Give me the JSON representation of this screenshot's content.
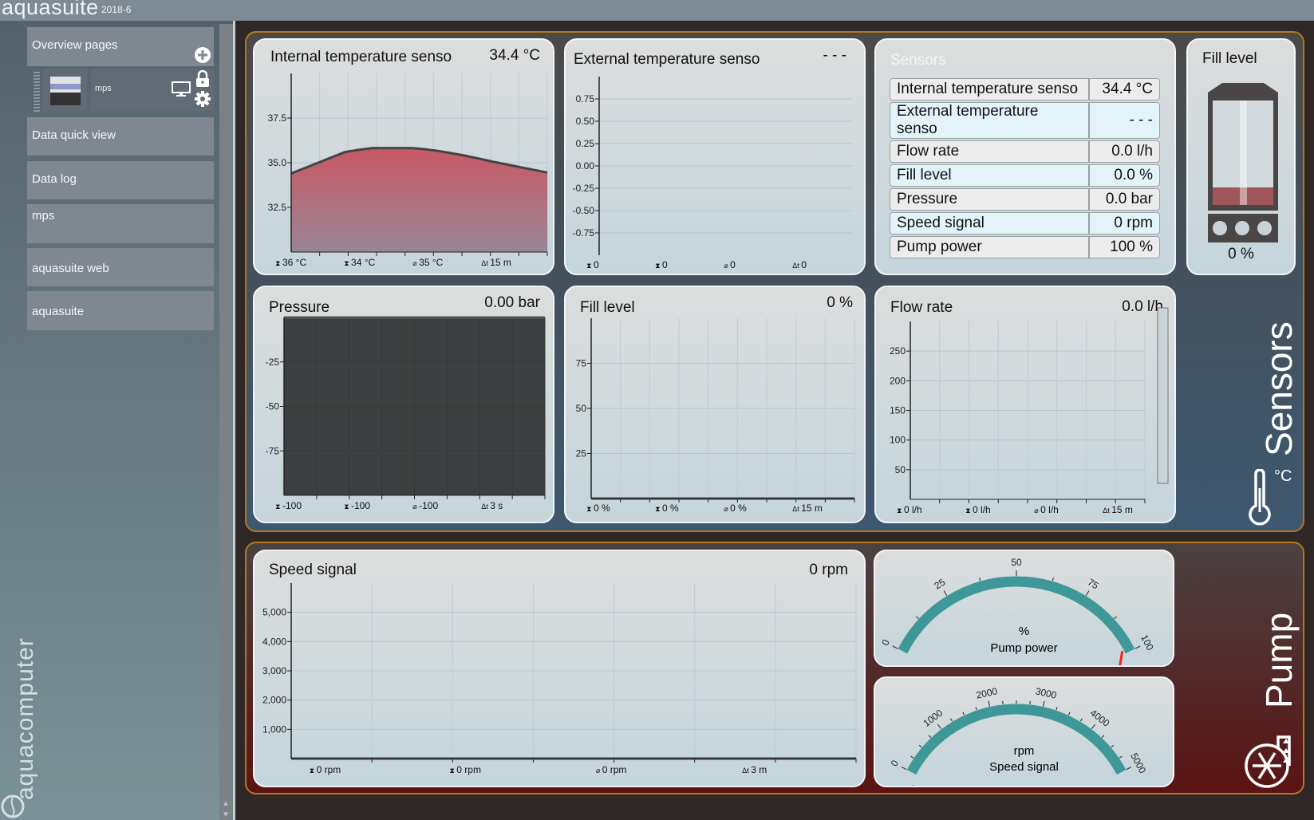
{
  "app": {
    "name": "aquasuite",
    "version": "2018-6",
    "logo_text": "aquacomputer"
  },
  "sidebar": {
    "overview_pages": "Overview pages",
    "page_item": {
      "label": "mps"
    },
    "items": [
      {
        "label": "Data quick view"
      },
      {
        "label": "Data log"
      },
      {
        "label": "mps"
      },
      {
        "label": "aquasuite web"
      },
      {
        "label": "aquasuite"
      }
    ]
  },
  "groups": {
    "sensors": "Sensors",
    "pump": "Pump",
    "temp_unit": "°C"
  },
  "sensor_table": {
    "title": "Sensors",
    "rows": [
      {
        "label": "Internal temperature senso",
        "value": "34.4 °C"
      },
      {
        "label": "External temperature senso",
        "value": "- - -"
      },
      {
        "label": "Flow rate",
        "value": "0.0 l/h"
      },
      {
        "label": "Fill level",
        "value": "0.0 %"
      },
      {
        "label": "Pressure",
        "value": "0.0 bar"
      },
      {
        "label": "Speed signal",
        "value": "0 rpm"
      },
      {
        "label": "Pump power",
        "value": "100 %"
      }
    ]
  },
  "fill_widget": {
    "title": "Fill level",
    "value": "0 %",
    "level_fraction": 0.1
  },
  "colors": {
    "accent": "#b1781e",
    "gauge": "#3f9898",
    "temp_fill": "#c85a64",
    "row_a": "#ececec",
    "row_b": "#e2f3fa"
  },
  "chart_data": [
    {
      "id": "internal",
      "type": "area",
      "title": "Internal temperature senso",
      "value": "34.4 °C",
      "ylim": [
        30,
        40
      ],
      "yticks": [
        37.5,
        35.0,
        32.5
      ],
      "ytick_labels": [
        "37.5",
        "35.0",
        "32.5"
      ],
      "values": [
        34.4,
        34.7,
        35.0,
        35.3,
        35.6,
        35.72,
        35.82,
        35.82,
        35.82,
        35.82,
        35.75,
        35.65,
        35.52,
        35.38,
        35.22,
        35.05,
        34.9,
        34.75,
        34.6,
        34.45
      ],
      "stats": [
        {
          "icon": "max",
          "label": "36 °C"
        },
        {
          "icon": "min",
          "label": "34 °C"
        },
        {
          "icon": "avg",
          "label": "35 °C"
        },
        {
          "icon": "dt",
          "label": "15 m"
        }
      ]
    },
    {
      "id": "external",
      "type": "line",
      "title": "External temperature senso",
      "value": "- - -",
      "ylim": [
        -1,
        1
      ],
      "yticks": [
        0.75,
        0.5,
        0.25,
        0,
        -0.25,
        -0.5,
        -0.75
      ],
      "ytick_labels": [
        "0.75",
        "0.50",
        "0.25",
        "0.00",
        "-0.25",
        "-0.50",
        "-0.75"
      ],
      "values": [],
      "stats": [
        {
          "icon": "max",
          "label": "0"
        },
        {
          "icon": "min",
          "label": "0"
        },
        {
          "icon": "avg",
          "label": "0"
        },
        {
          "icon": "dt",
          "label": "0"
        }
      ]
    },
    {
      "id": "pressure",
      "type": "area",
      "title": "Pressure",
      "value": "0.00 bar",
      "ylim": [
        -100,
        0
      ],
      "yticks": [
        -25,
        -50,
        -75
      ],
      "ytick_labels": [
        "-25",
        "-50",
        "-75"
      ],
      "values": [
        0,
        0
      ],
      "stats": [
        {
          "icon": "max",
          "label": "-100"
        },
        {
          "icon": "min",
          "label": "-100"
        },
        {
          "icon": "avg",
          "label": "-100"
        },
        {
          "icon": "dt",
          "label": "3 s"
        }
      ]
    },
    {
      "id": "fill",
      "type": "line",
      "title": "Fill level",
      "value": "0 %",
      "ylim": [
        0,
        100
      ],
      "yticks": [
        75,
        50,
        25
      ],
      "ytick_labels": [
        "75",
        "50",
        "25"
      ],
      "values": [
        0,
        0
      ],
      "stats": [
        {
          "icon": "max",
          "label": "0 %"
        },
        {
          "icon": "min",
          "label": "0 %"
        },
        {
          "icon": "avg",
          "label": "0 %"
        },
        {
          "icon": "dt",
          "label": "15 m"
        }
      ]
    },
    {
      "id": "flow",
      "type": "line",
      "title": "Flow rate",
      "value": "0.0 l/h",
      "ylim": [
        0,
        300
      ],
      "yticks": [
        250,
        200,
        150,
        100,
        50
      ],
      "ytick_labels": [
        "250",
        "200",
        "150",
        "100",
        "50"
      ],
      "values": [],
      "stats": [
        {
          "icon": "max",
          "label": "0 l/h"
        },
        {
          "icon": "min",
          "label": "0 l/h"
        },
        {
          "icon": "avg",
          "label": "0 l/h"
        },
        {
          "icon": "dt",
          "label": "15 m"
        }
      ]
    },
    {
      "id": "speed",
      "type": "line",
      "title": "Speed signal",
      "value": "0 rpm",
      "ylim": [
        0,
        6000
      ],
      "yticks": [
        5000,
        4000,
        3000,
        2000,
        1000
      ],
      "ytick_labels": [
        "5,000",
        "4,000",
        "3,000",
        "2,000",
        "1,000"
      ],
      "values": [
        0,
        0
      ],
      "stats": [
        {
          "icon": "max",
          "label": "0 rpm"
        },
        {
          "icon": "min",
          "label": "0 rpm"
        },
        {
          "icon": "avg",
          "label": "0 rpm"
        },
        {
          "icon": "dt",
          "label": "3 m"
        }
      ]
    }
  ],
  "gauges": [
    {
      "id": "pump-power",
      "unit": "%",
      "label": "Pump power",
      "min": 0,
      "max": 100,
      "value": 100,
      "major": [
        0,
        25,
        50,
        75,
        100
      ],
      "minor_step": 12.5
    },
    {
      "id": "speed-signal",
      "unit": "rpm",
      "label": "Speed signal",
      "min": 0,
      "max": 5000,
      "value": 0,
      "major": [
        0,
        1000,
        2000,
        3000,
        4000,
        5000
      ],
      "minor_step": 250
    }
  ]
}
